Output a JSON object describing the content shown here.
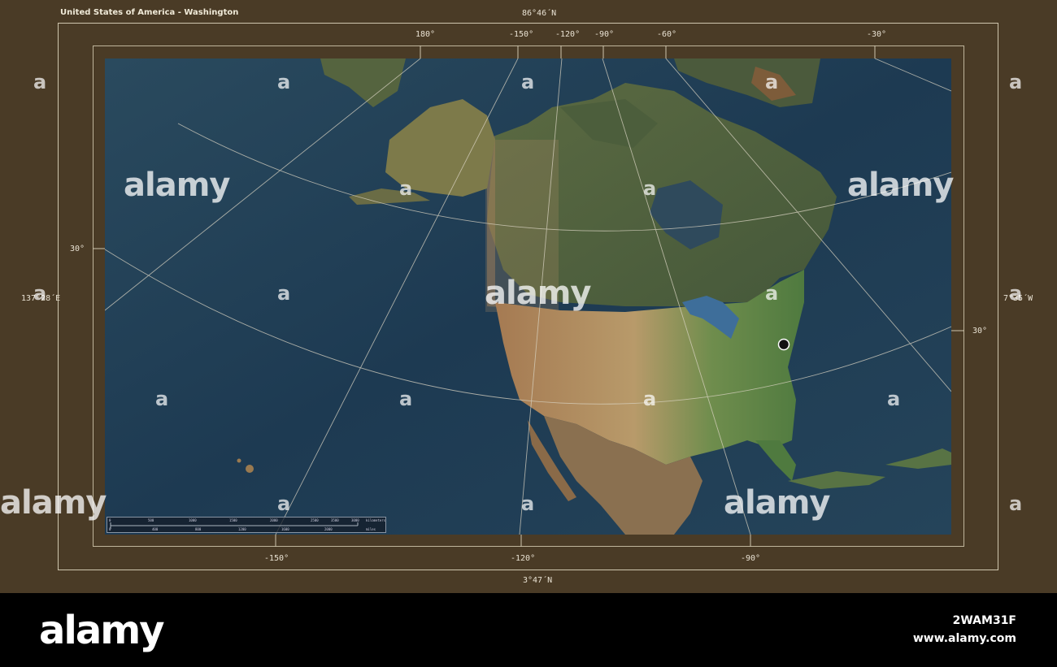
{
  "title": "United States of America - Washington",
  "corner_labels": {
    "top": "86°46´N",
    "bottom": "3°47´N",
    "left": "137°28´E",
    "right": "7°35´W"
  },
  "top_ticks": [
    "180°",
    "-150°",
    "-120°",
    "-90°",
    "-60°",
    "-30°"
  ],
  "bottom_ticks": [
    "-150°",
    "-120°",
    "-90°"
  ],
  "left_ticks": [
    "30°"
  ],
  "right_ticks": [
    "30°"
  ],
  "scale_bar": {
    "kilometers_label": "kilometers",
    "miles_label": "miles",
    "km_values": [
      "0",
      "500",
      "1000",
      "1500",
      "2000",
      "2500",
      "3000",
      "3500"
    ],
    "mi_values": [
      "0",
      "400",
      "800",
      "1200",
      "1600",
      "2000"
    ]
  },
  "marker": {
    "place": "Washington"
  },
  "watermark": {
    "text": "alamy",
    "letter": "a"
  },
  "footer": {
    "logo": "alamy",
    "image_id": "2WAM31F",
    "url": "www.alamy.com"
  },
  "colors": {
    "frame": "#4a3b26",
    "ocean": "#1f3a4e",
    "land": "#7a8a55",
    "highlight": "#8a6a45"
  }
}
